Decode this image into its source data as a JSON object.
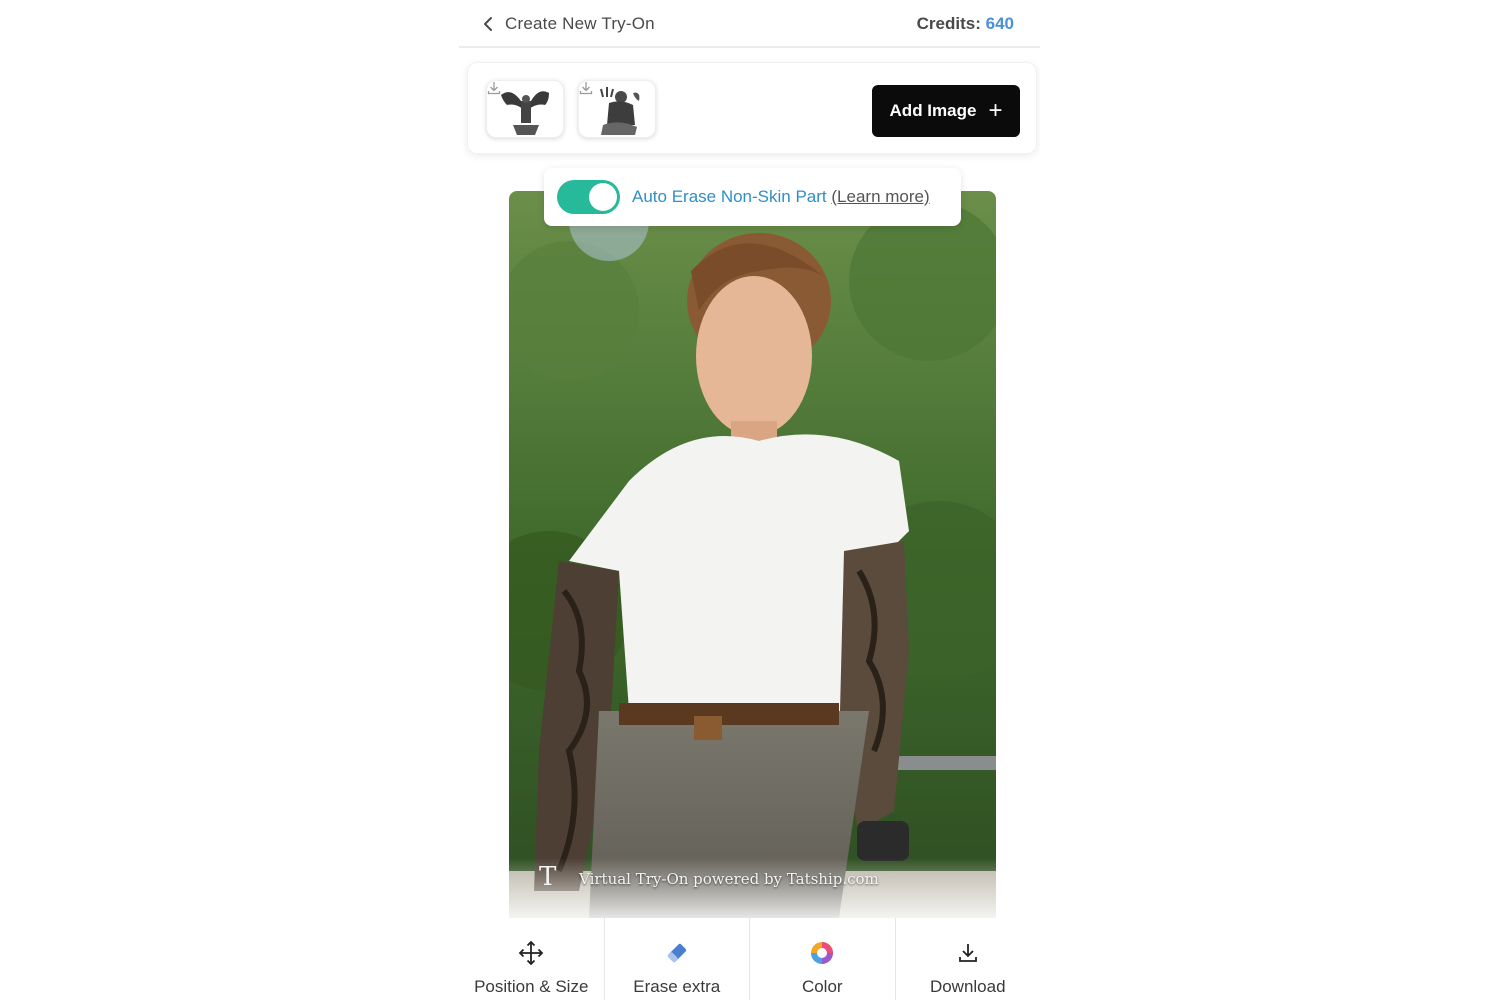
{
  "header": {
    "back_icon": "chevron-left-icon",
    "title": "Create New Try-On",
    "credits_label": "Credits:",
    "credits_value": "640",
    "credits_color": "#4a90d9"
  },
  "image_strip": {
    "thumbnails": [
      {
        "name": "tattoo-design-angel",
        "icon": "download-icon"
      },
      {
        "name": "tattoo-design-poseidon",
        "icon": "download-icon"
      }
    ],
    "add_button_label": "Add Image",
    "add_button_icon": "plus-icon"
  },
  "auto_erase": {
    "enabled": true,
    "label": "Auto Erase Non-Skin Part",
    "link": "(Learn more)",
    "accent": "#26b99a"
  },
  "preview": {
    "caption_mark": "T",
    "caption": "Virtual Try-On powered by Tatship.com"
  },
  "toolbar": {
    "items": [
      {
        "label": "Position & Size",
        "icon": "move-icon"
      },
      {
        "label": "Erase extra",
        "icon": "eraser-icon"
      },
      {
        "label": "Color",
        "icon": "color-wheel-icon"
      },
      {
        "label": "Download",
        "icon": "download-icon"
      }
    ]
  }
}
